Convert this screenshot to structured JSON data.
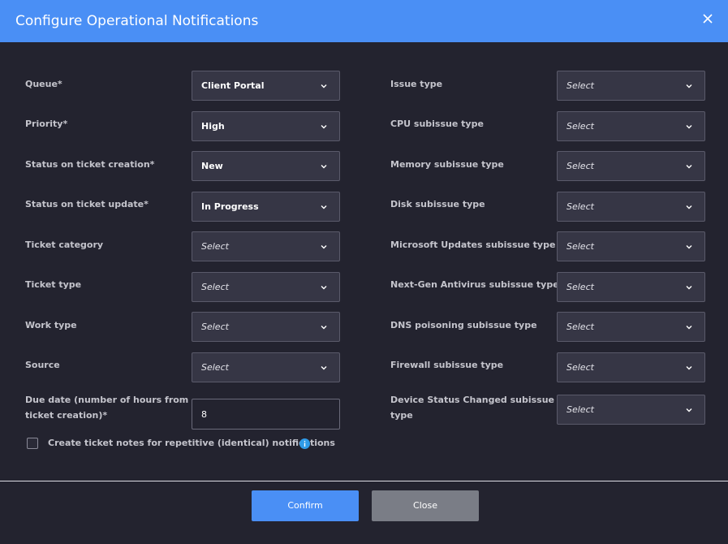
{
  "dialog": {
    "title": "Configure Operational Notifications",
    "close_icon": "close-icon"
  },
  "left_fields": [
    {
      "label": "Queue*",
      "value": "Client Portal",
      "placeholder": false
    },
    {
      "label": "Priority*",
      "value": "High",
      "placeholder": false
    },
    {
      "label": "Status on ticket creation*",
      "value": "New",
      "placeholder": false
    },
    {
      "label": "Status on ticket update*",
      "value": "In Progress",
      "placeholder": false
    },
    {
      "label": "Ticket category",
      "value": "Select",
      "placeholder": true
    },
    {
      "label": "Ticket type",
      "value": "Select",
      "placeholder": true
    },
    {
      "label": "Work type",
      "value": "Select",
      "placeholder": true
    },
    {
      "label": "Source",
      "value": "Select",
      "placeholder": true
    }
  ],
  "due_date": {
    "label_line1": "Due date (number of hours from",
    "label_line2": "ticket creation)*",
    "value": "8"
  },
  "right_fields": [
    {
      "label": "Issue type",
      "value": "Select",
      "placeholder": true
    },
    {
      "label": "CPU subissue type",
      "value": "Select",
      "placeholder": true
    },
    {
      "label": "Memory subissue type",
      "value": "Select",
      "placeholder": true
    },
    {
      "label": "Disk subissue type",
      "value": "Select",
      "placeholder": true
    },
    {
      "label": "Microsoft Updates subissue type",
      "value": "Select",
      "placeholder": true
    },
    {
      "label": "Next-Gen Antivirus subissue type",
      "value": "Select",
      "placeholder": true
    },
    {
      "label": "DNS poisoning subissue type",
      "value": "Select",
      "placeholder": true
    },
    {
      "label": "Firewall subissue type",
      "value": "Select",
      "placeholder": true
    }
  ],
  "device_status": {
    "label_line1": "Device Status Changed subissue",
    "label_line2": "type",
    "value": "Select"
  },
  "repetitive_notes": {
    "label": "Create ticket notes for repetitive (identical) notifications",
    "checked": false
  },
  "footer": {
    "confirm_label": "Confirm",
    "close_label": "Close"
  },
  "colors": {
    "accent": "#4a8ff5",
    "background": "#23232f",
    "field": "#363645",
    "secondary_button": "#7a7d86"
  }
}
